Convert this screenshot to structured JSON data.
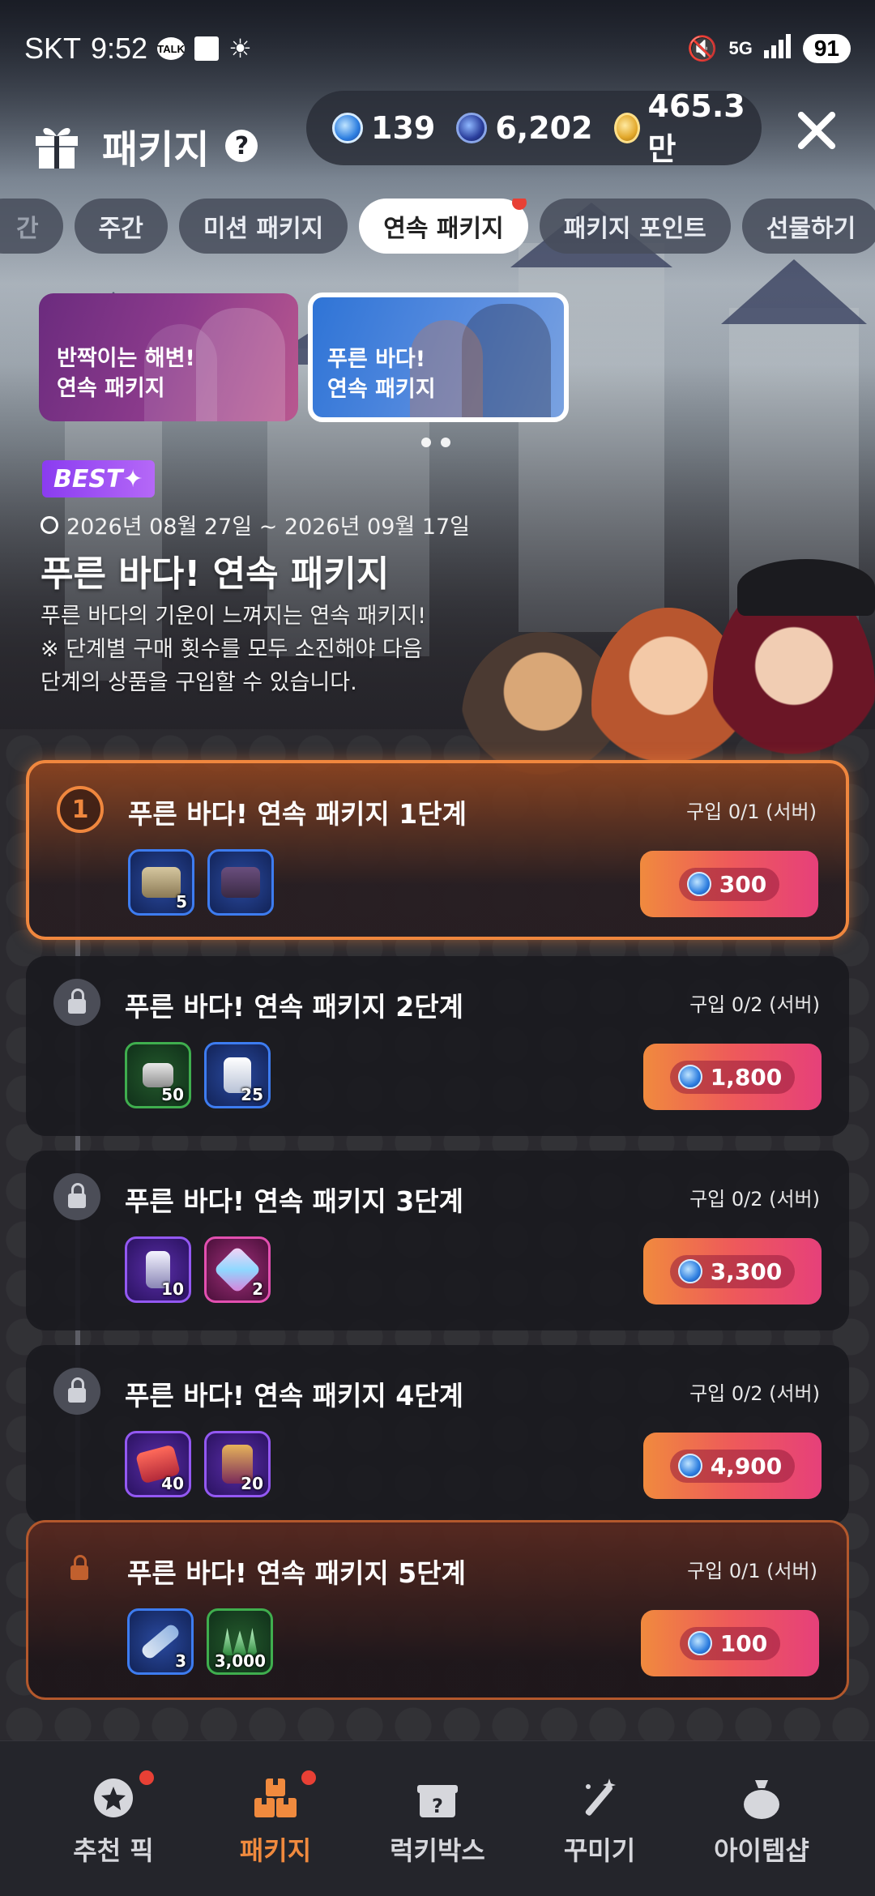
{
  "status_bar": {
    "carrier": "SKT",
    "time": "9:52",
    "talk": "TALK",
    "network": "5G",
    "battery": "91"
  },
  "header": {
    "title": "패키지",
    "help": "?",
    "currencies": [
      {
        "icon": "blue-gem-icon",
        "value": "139"
      },
      {
        "icon": "dark-gem-icon",
        "value": "6,202"
      },
      {
        "icon": "gold-coin-icon",
        "value": "465.3만"
      }
    ]
  },
  "tabs": [
    {
      "label": "간",
      "active": false
    },
    {
      "label": "주간",
      "active": false
    },
    {
      "label": "미션 패키지",
      "active": false
    },
    {
      "label": "연속 패키지",
      "active": true,
      "dot": true
    },
    {
      "label": "패키지 포인트",
      "active": false
    },
    {
      "label": "선물하기",
      "active": false
    }
  ],
  "banners": [
    {
      "text": "반짝이는 해변!\n연속 패키지",
      "selected": false
    },
    {
      "text": "푸른 바다!\n연속 패키지",
      "selected": true
    }
  ],
  "info": {
    "badge": "BEST",
    "period": "2026년 08월 27일 ~ 2026년 09월 17일",
    "title": "푸른 바다! 연속 패키지",
    "description": "푸른 바다의 기운이 느껴지는 연속 패키지!\n※ 단계별 구매 횟수를 모두 소진해야 다음\n단계의 상품을 구입할 수 있습니다."
  },
  "steps": [
    {
      "number": "1",
      "locked": false,
      "title": "푸른 바다! 연속 패키지 1단계",
      "limit": "구입 0/1 (서버)",
      "price": "300",
      "items": [
        {
          "frame": "blue",
          "qty": "5",
          "icon": "silver-chest-icon"
        },
        {
          "frame": "blue",
          "qty": "",
          "icon": "treasure-chest-icon"
        }
      ]
    },
    {
      "number": "2",
      "locked": true,
      "title": "푸른 바다! 연속 패키지 2단계",
      "limit": "구입 0/2 (서버)",
      "price": "1,800",
      "items": [
        {
          "frame": "green",
          "qty": "50",
          "icon": "ore-icon"
        },
        {
          "frame": "blue",
          "qty": "25",
          "icon": "crystal-icon"
        }
      ]
    },
    {
      "number": "3",
      "locked": true,
      "title": "푸른 바다! 연속 패키지 3단계",
      "limit": "구입 0/2 (서버)",
      "price": "3,300",
      "items": [
        {
          "frame": "purple",
          "qty": "10",
          "icon": "gem-shard-icon"
        },
        {
          "frame": "pink",
          "qty": "2",
          "icon": "prism-gem-icon"
        }
      ]
    },
    {
      "number": "4",
      "locked": true,
      "title": "푸른 바다! 연속 패키지 4단계",
      "limit": "구입 0/2 (서버)",
      "price": "4,900",
      "items": [
        {
          "frame": "purple",
          "qty": "40",
          "icon": "ticket-icon"
        },
        {
          "frame": "purple",
          "qty": "20",
          "icon": "card-icon"
        }
      ]
    },
    {
      "number": "5",
      "locked": true,
      "title": "푸른 바다! 연속 패키지 5단계",
      "limit": "구입 0/1 (서버)",
      "price": "100",
      "items": [
        {
          "frame": "blue",
          "qty": "3",
          "icon": "scroll-icon"
        },
        {
          "frame": "green",
          "qty": "3,000",
          "icon": "grass-icon"
        }
      ]
    }
  ],
  "bottom_nav": [
    {
      "label": "추천 픽",
      "icon": "star-badge-icon",
      "dot": true,
      "active": false
    },
    {
      "label": "패키지",
      "icon": "boxes-icon",
      "dot": true,
      "active": true
    },
    {
      "label": "럭키박스",
      "icon": "mystery-box-icon",
      "dot": false,
      "active": false
    },
    {
      "label": "꾸미기",
      "icon": "magic-wand-icon",
      "dot": false,
      "active": false
    },
    {
      "label": "아이템샵",
      "icon": "money-bag-icon",
      "dot": false,
      "active": false
    }
  ],
  "colors": {
    "accent": "#f08a3e",
    "price_gradient_end": "#e6407a",
    "notification_dot": "#e84035",
    "best_badge": "#8a3cf0"
  }
}
